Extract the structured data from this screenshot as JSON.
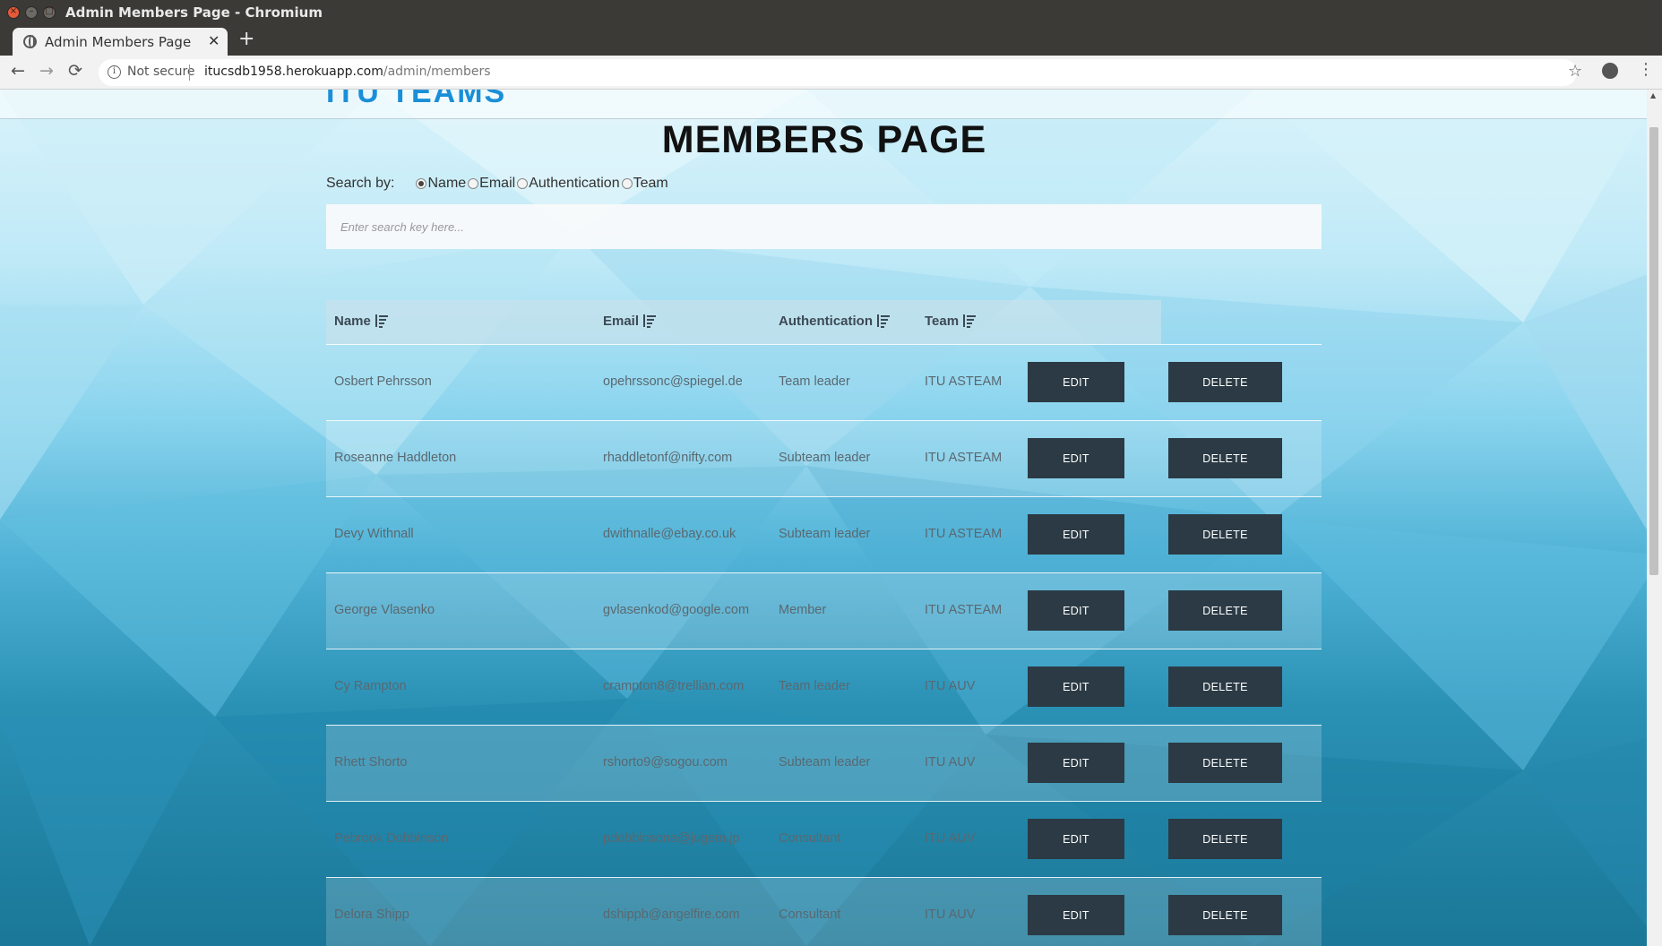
{
  "window": {
    "title": "Admin Members Page - Chromium"
  },
  "tab": {
    "title": "Admin Members Page",
    "close": "✕",
    "new_tab": "+"
  },
  "toolbar": {
    "back": "←",
    "forward": "→",
    "reload": "⟳",
    "security": "Not secure",
    "url_host": "itucsdb1958.herokuapp.com",
    "url_path": "/admin/members",
    "star": "☆",
    "menu": "⋮"
  },
  "page": {
    "logo_fragment": "ITU TEAMS",
    "title": "MEMBERS PAGE",
    "search_label": "Search by:",
    "search_options": [
      "Name",
      "Email",
      "Authentication",
      "Team"
    ],
    "search_selected": "Name",
    "search_placeholder": "Enter search key here..."
  },
  "table": {
    "headers": [
      "Name",
      "Email",
      "Authentication",
      "Team"
    ],
    "edit_label": "EDIT",
    "delete_label": "DELETE",
    "rows": [
      {
        "name": "Osbert Pehrsson",
        "email": "opehrssonc@spiegel.de",
        "auth": "Team leader",
        "team": "ITU ASTEAM"
      },
      {
        "name": "Roseanne Haddleton",
        "email": "rhaddletonf@nifty.com",
        "auth": "Subteam leader",
        "team": "ITU ASTEAM"
      },
      {
        "name": "Devy Withnall",
        "email": "dwithnalle@ebay.co.uk",
        "auth": "Subteam leader",
        "team": "ITU ASTEAM"
      },
      {
        "name": "George Vlasenko",
        "email": "gvlasenkod@google.com",
        "auth": "Member",
        "team": "ITU ASTEAM"
      },
      {
        "name": "Cy Rampton",
        "email": "crampton8@trellian.com",
        "auth": "Team leader",
        "team": "ITU AUV"
      },
      {
        "name": "Rhett Shorto",
        "email": "rshorto9@sogou.com",
        "auth": "Subteam leader",
        "team": "ITU AUV"
      },
      {
        "name": "Pebrook Dobbinson",
        "email": "pdobbinsona@jugem.jp",
        "auth": "Consultant",
        "team": "ITU AUV"
      },
      {
        "name": "Delora Shipp",
        "email": "dshippb@angelfire.com",
        "auth": "Consultant",
        "team": "ITU AUV"
      }
    ]
  },
  "colors": {
    "button_bg": "#2b3a44",
    "title": "#111111"
  }
}
